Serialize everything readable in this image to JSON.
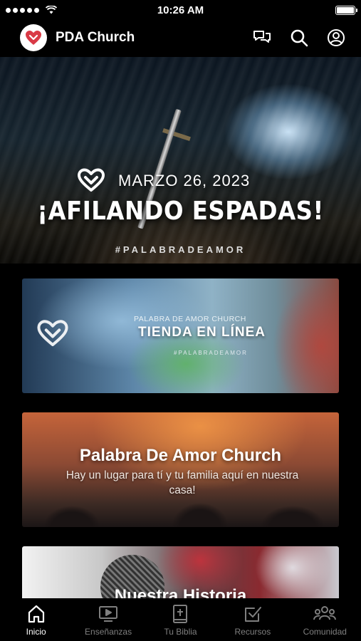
{
  "status_bar": {
    "time": "10:26 AM",
    "battery_level": 1.0
  },
  "header": {
    "app_title": "PDA Church",
    "logo_icon": "heart-logo-icon"
  },
  "hero": {
    "date": "MARZO 26, 2023",
    "title": "¡AFILANDO ESPADAS!",
    "hashtag": "#PALABRADEAMOR"
  },
  "store_card": {
    "subtitle": "PALABRA DE AMOR CHURCH",
    "title": "TIENDA EN LÍNEA",
    "hashtag": "#PALABRADEAMOR"
  },
  "church_card": {
    "title": "Palabra De Amor Church",
    "subtitle": "Hay un lugar para tí y tu familia aquí en nuestra casa!"
  },
  "history_card": {
    "title": "Nuestra Historia"
  },
  "tabs": [
    {
      "label": "Inicio",
      "icon": "home-icon",
      "active": true
    },
    {
      "label": "Enseñanzas",
      "icon": "tv-icon",
      "active": false
    },
    {
      "label": "Tu Biblia",
      "icon": "bible-icon",
      "active": false
    },
    {
      "label": "Recursos",
      "icon": "checkbox-icon",
      "active": false
    },
    {
      "label": "Comunidad",
      "icon": "community-icon",
      "active": false
    }
  ],
  "colors": {
    "background": "#000000",
    "tab_active": "#ffffff",
    "tab_inactive": "#7f7f7f",
    "brand": "#d93a46"
  }
}
